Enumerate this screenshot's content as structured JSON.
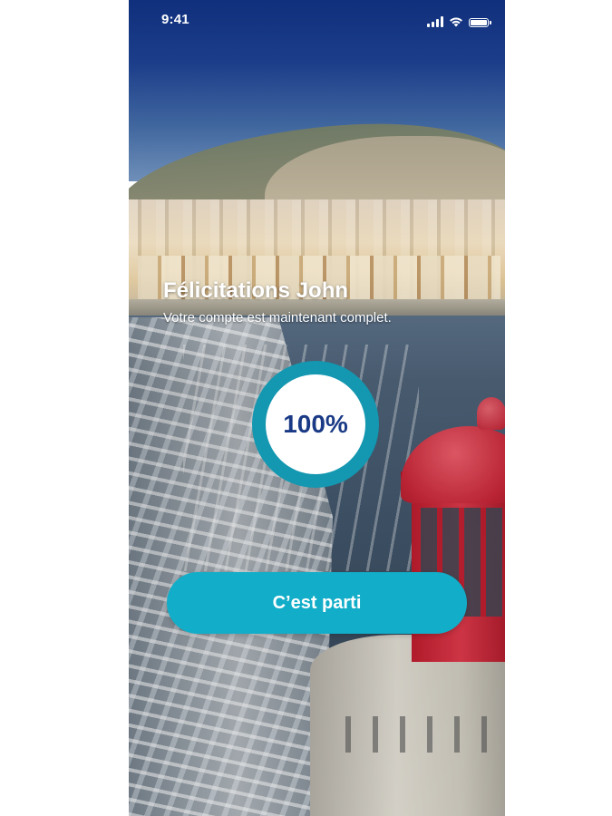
{
  "status_bar": {
    "time": "9:41",
    "icons": [
      "cellular-signal-icon",
      "wifi-icon",
      "battery-icon"
    ]
  },
  "background": {
    "image": "harbor-with-red-lighthouse-photo"
  },
  "content": {
    "title": "Félicitations John",
    "subtitle": "Votre compte est maintenant complet.",
    "progress_label": "100%",
    "progress_value": 1.0,
    "cta_label": "C’est parti"
  },
  "colors": {
    "accent": "#12adc8",
    "ring": "#1497b0",
    "progress_text": "#1a3a86",
    "sky": "#102f7c"
  }
}
